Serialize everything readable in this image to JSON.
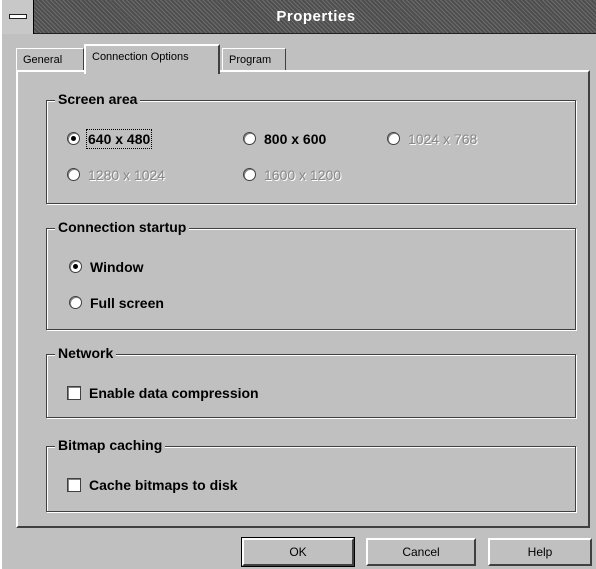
{
  "window": {
    "title": "Properties"
  },
  "tabs": [
    {
      "label": "General"
    },
    {
      "label": "Connection Options"
    },
    {
      "label": "Program"
    }
  ],
  "screen_area": {
    "label": "Screen area",
    "options": [
      {
        "label": "640 x 480",
        "state": "selected"
      },
      {
        "label": "800 x 600",
        "state": "enabled"
      },
      {
        "label": "1024 x 768",
        "state": "disabled"
      },
      {
        "label": "1280 x 1024",
        "state": "disabled"
      },
      {
        "label": "1600 x 1200",
        "state": "disabled"
      }
    ]
  },
  "connection_startup": {
    "label": "Connection startup",
    "options": [
      {
        "label": "Window",
        "state": "selected"
      },
      {
        "label": "Full screen",
        "state": "enabled"
      }
    ]
  },
  "network": {
    "label": "Network",
    "enable_compression": {
      "label": "Enable data compression",
      "checked": false
    }
  },
  "bitmap_caching": {
    "label": "Bitmap caching",
    "cache_to_disk": {
      "label": "Cache bitmaps to disk",
      "checked": false
    }
  },
  "buttons": {
    "ok": "OK",
    "cancel": "Cancel",
    "help": "Help"
  }
}
